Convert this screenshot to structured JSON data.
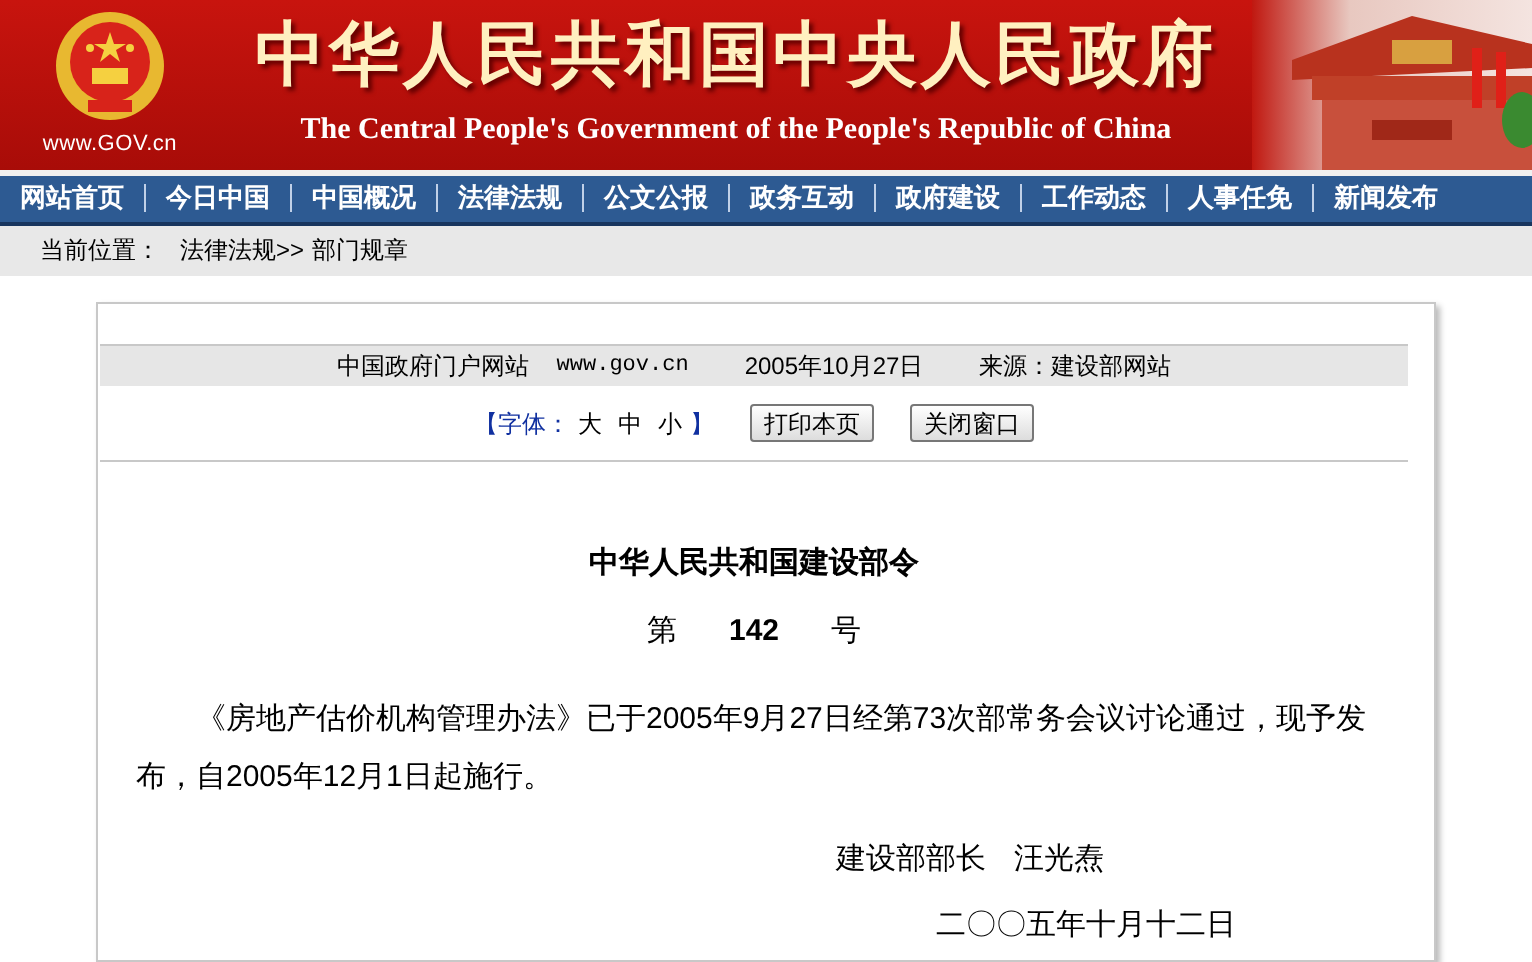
{
  "header": {
    "title": "中华人民共和国中央人民政府",
    "subtitle": "The Central People's Government of the People's Republic of China",
    "site": "www.GOV.cn"
  },
  "nav": [
    {
      "label": "网站首页"
    },
    {
      "label": "今日中国"
    },
    {
      "label": "中国概况"
    },
    {
      "label": "法律法规"
    },
    {
      "label": "公文公报"
    },
    {
      "label": "政务互动"
    },
    {
      "label": "政府建设"
    },
    {
      "label": "工作动态"
    },
    {
      "label": "人事任免"
    },
    {
      "label": "新闻发布"
    }
  ],
  "breadcrumb": {
    "label": "当前位置：",
    "path": "法律法规>>",
    "current": "部门规章"
  },
  "info_bar": {
    "site": "中国政府门户网站",
    "url": "www.gov.cn",
    "date": "2005年10月27日",
    "source": "来源：建设部网站"
  },
  "font_size": {
    "label_open": "【字体：",
    "options": [
      "大",
      "中",
      "小"
    ],
    "label_close": "】"
  },
  "buttons": [
    "打印本页",
    "关闭窗口"
  ],
  "article": {
    "title": "中华人民共和国建设部令",
    "number_prefix": "第",
    "number": "142",
    "number_suffix": "号",
    "body": "《房地产估价机构管理办法》已于2005年9月27日经第73次部常务会议讨论通过，现予发布，自2005年12月1日起施行。",
    "signature": {
      "role": "建设部部长",
      "name": "汪光焘"
    },
    "date": "二〇〇五年十月十二日"
  }
}
